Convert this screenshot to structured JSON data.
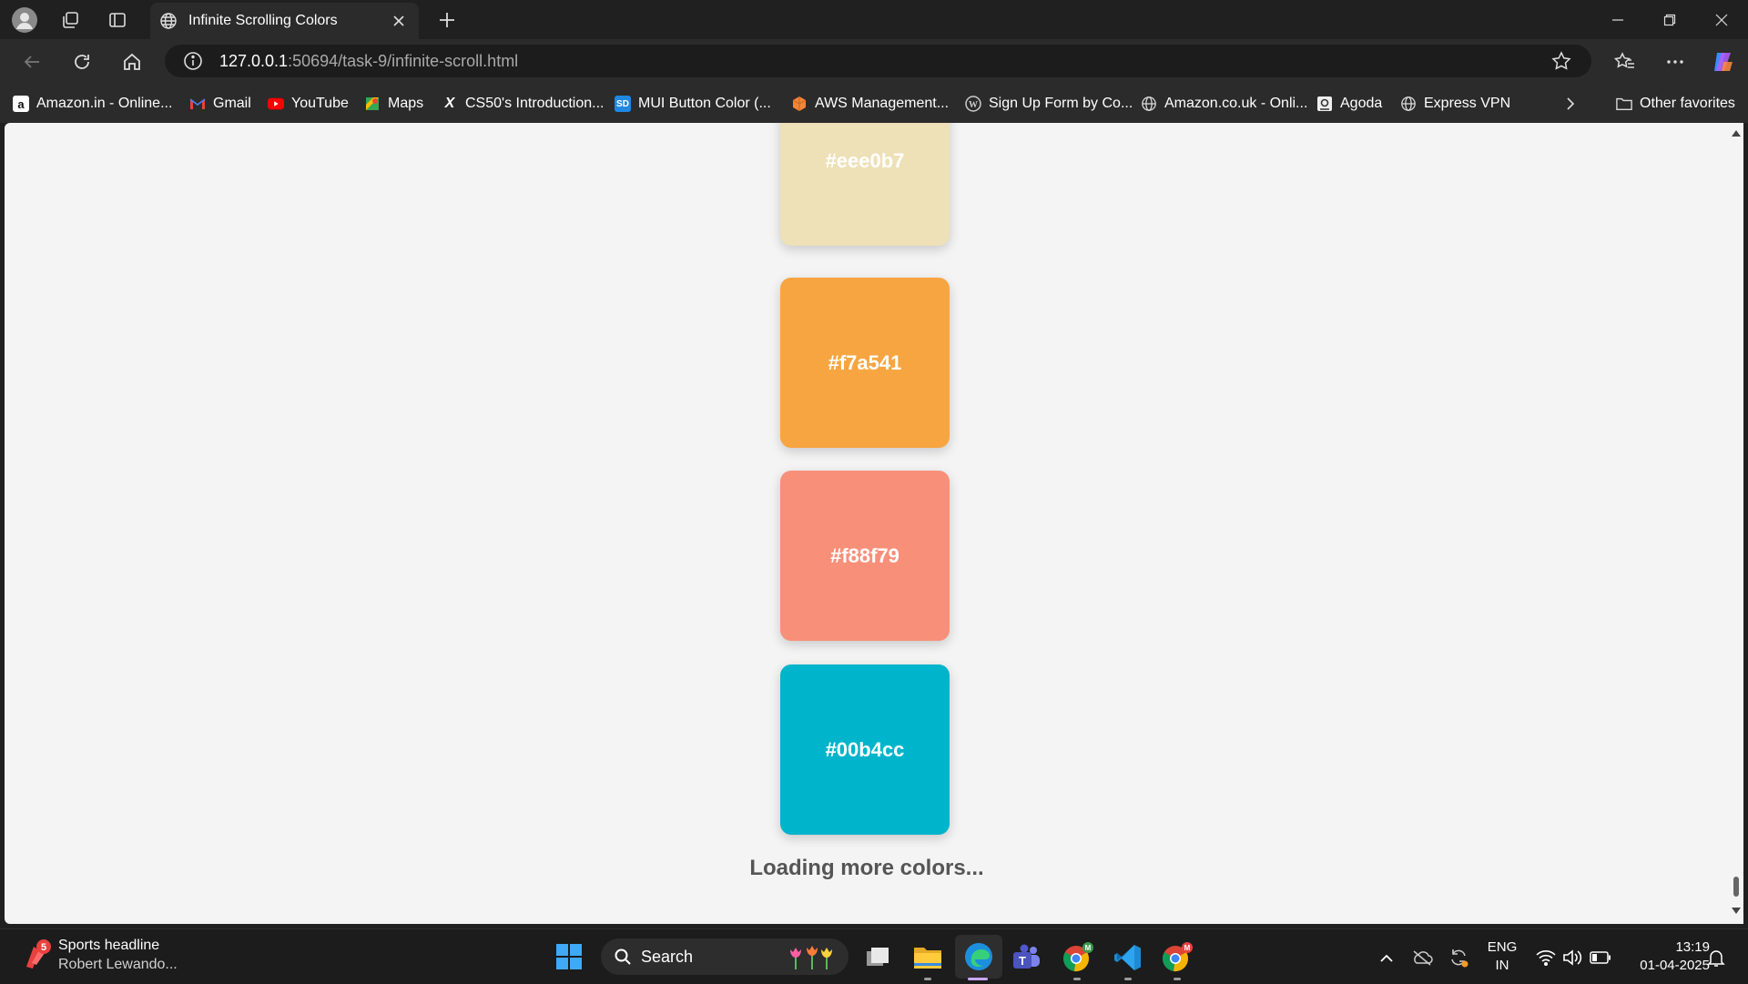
{
  "browser": {
    "tab_title": "Infinite Scrolling Colors",
    "url_host": "127.0.0.1",
    "url_rest": ":50694/task-9/infinite-scroll.html"
  },
  "bookmarks": [
    {
      "label": "Amazon.in - Online...",
      "icon": "amazon-icon"
    },
    {
      "label": "Gmail",
      "icon": "gmail-icon"
    },
    {
      "label": "YouTube",
      "icon": "youtube-icon"
    },
    {
      "label": "Maps",
      "icon": "maps-icon"
    },
    {
      "label": "CS50's Introduction...",
      "icon": "cs50-icon"
    },
    {
      "label": "MUI Button Color (...",
      "icon": "sd-icon"
    },
    {
      "label": "AWS Management...",
      "icon": "aws-icon"
    },
    {
      "label": "Sign Up Form by Co...",
      "icon": "wordpress-icon"
    },
    {
      "label": "Amazon.co.uk - Onli...",
      "icon": "globe-icon"
    },
    {
      "label": "Agoda",
      "icon": "agoda-icon"
    },
    {
      "label": "Express VPN",
      "icon": "globe-icon"
    }
  ],
  "other_favorites": "Other favorites",
  "page": {
    "swatches": [
      {
        "label": "#eee0b7",
        "color": "#eee0b7"
      },
      {
        "label": "#f7a541",
        "color": "#f7a541"
      },
      {
        "label": "#f88f79",
        "color": "#f88f79"
      },
      {
        "label": "#00b4cc",
        "color": "#00b4cc"
      }
    ],
    "loading_text": "Loading more colors..."
  },
  "taskbar": {
    "news_badge": "5",
    "news_title": "Sports headline",
    "news_sub": "Robert Lewando...",
    "search_label": "Search",
    "lang_top": "ENG",
    "lang_bottom": "IN",
    "time": "13:19",
    "date": "01-04-2025"
  }
}
